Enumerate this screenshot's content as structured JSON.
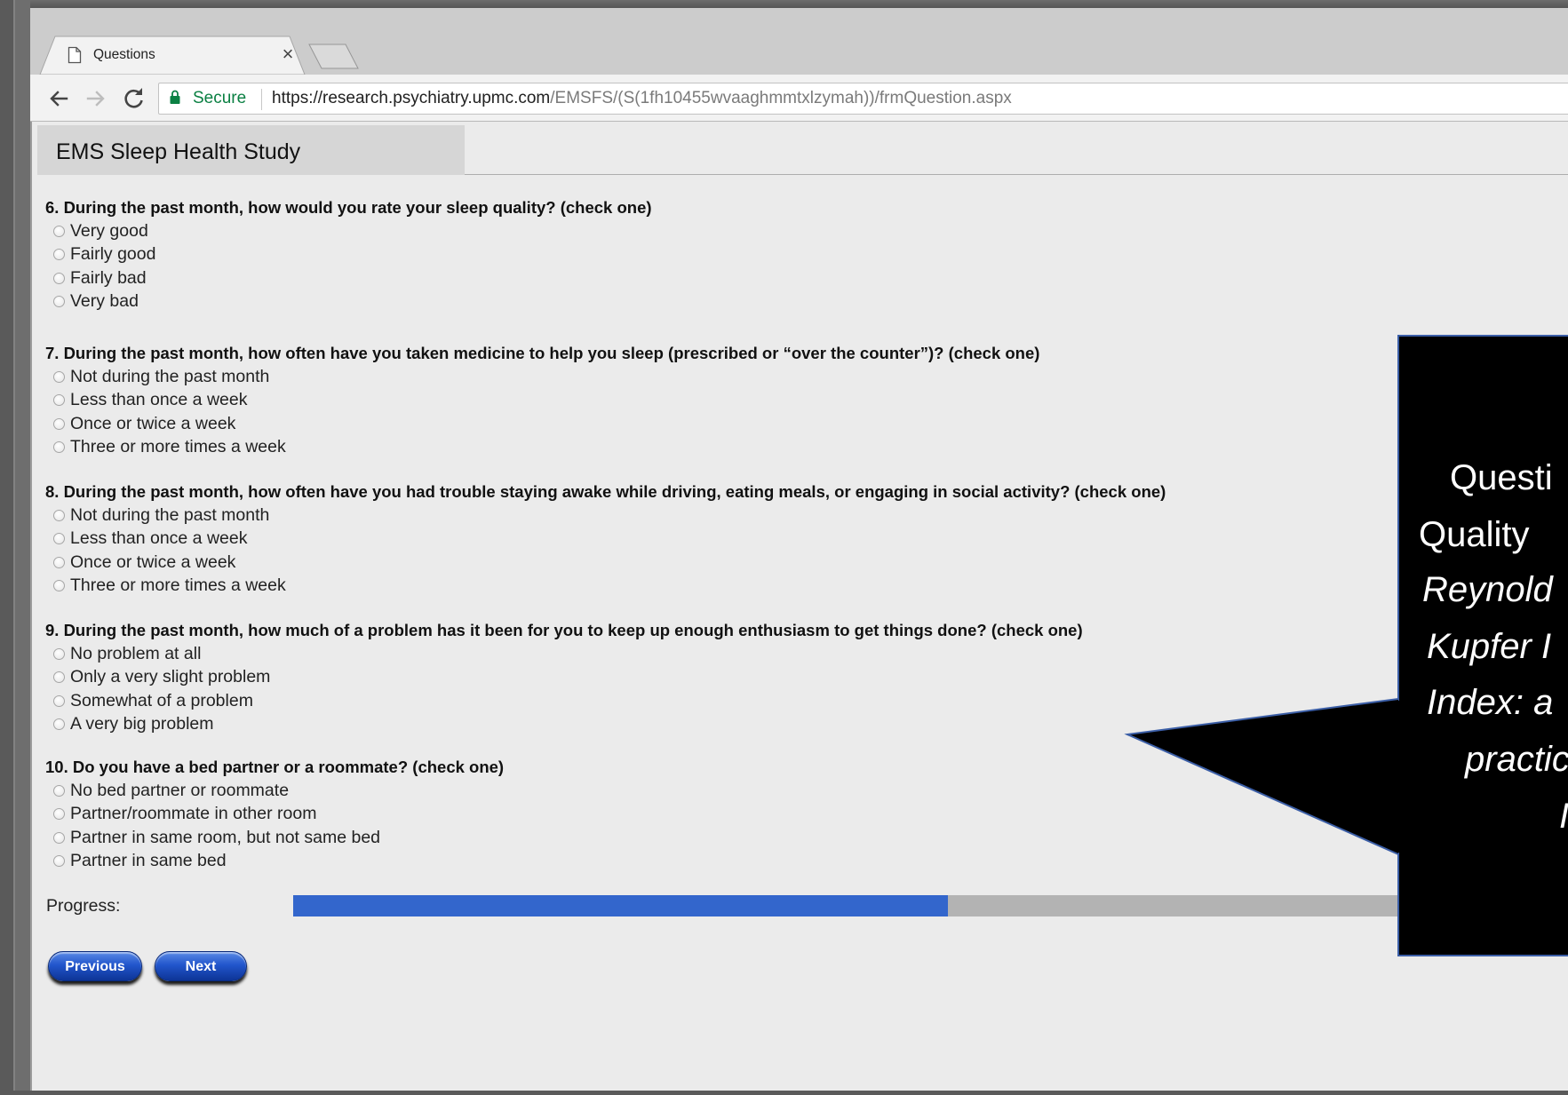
{
  "browser": {
    "tab_title": "Questions",
    "secure_label": "Secure",
    "url_host": "https://research.psychiatry.upmc.com",
    "url_path": "/EMSFS/(S(1fh10455wvaaghmmtxlzymah))/frmQuestion.aspx",
    "icons": {
      "tab": "page-icon",
      "close": "close-icon",
      "back": "back-arrow-icon",
      "forward": "forward-arrow-icon",
      "reload": "reload-icon",
      "lock": "lock-icon",
      "new_tab": "new-tab-icon"
    }
  },
  "page": {
    "site_title": "EMS Sleep Health Study"
  },
  "questions": [
    {
      "text": "6. During the past month, how would you rate your sleep quality? (check one)",
      "options": [
        "Very good",
        "Fairly good",
        "Fairly bad",
        "Very bad"
      ]
    },
    {
      "text": "7. During the past month, how often have you taken medicine to help you sleep (prescribed or “over the counter”)? (check one)",
      "options": [
        "Not during the past month",
        "Less than once a week",
        "Once or twice a week",
        "Three or more times a week"
      ]
    },
    {
      "text": "8. During the past month, how often have you had trouble staying awake while driving, eating meals, or engaging in social activity? (check one)",
      "options": [
        "Not during the past month",
        "Less than once a week",
        "Once or twice a week",
        "Three or more times a week"
      ]
    },
    {
      "text": "9. During the past month, how much of a problem has it been for you to keep up enough enthusiasm to get things done? (check one)",
      "options": [
        "No problem at all",
        "Only a very slight problem",
        "Somewhat of a problem",
        "A very big problem"
      ]
    },
    {
      "text": "10. Do you have a bed partner or a roommate? (check one)",
      "options": [
        "No bed partner or roommate",
        "Partner/roommate in other room",
        "Partner in same room, but not same bed",
        "Partner in same bed"
      ]
    }
  ],
  "progress": {
    "label": "Progress:",
    "fraction": 0.54
  },
  "buttons": {
    "previous": "Previous",
    "next": "Next"
  },
  "callout": {
    "lines": [
      "Questi",
      "Quality",
      "Reynold",
      "Kupfer I",
      "Index: a",
      "practic",
      "I"
    ]
  },
  "colors": {
    "progress_fill": "#3366cc",
    "progress_track": "#b3b3b3",
    "secure_green": "#0b8043",
    "callout_background": "#000000",
    "callout_border": "#3b5ea6"
  }
}
